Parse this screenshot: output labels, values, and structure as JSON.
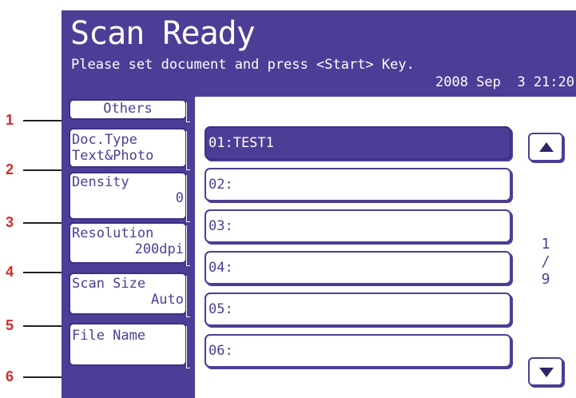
{
  "callouts": [
    "1",
    "2",
    "3",
    "4",
    "5",
    "6"
  ],
  "header": {
    "title": "Scan Ready",
    "subtitle": "Please set document and press <Start> Key.",
    "datetime": "2008 Sep  3 21:20"
  },
  "functions": {
    "others": "Others",
    "doc_type": {
      "label": "Doc.Type",
      "value": "Text&Photo"
    },
    "density": {
      "label": "Density",
      "value": "0"
    },
    "resolution": {
      "label": "Resolution",
      "value": "200dpi"
    },
    "scan_size": {
      "label": "Scan Size",
      "value": "Auto"
    },
    "file_name": {
      "label": "File Name",
      "value": ""
    }
  },
  "list": {
    "rows": [
      "01:TEST1",
      "02:",
      "03:",
      "04:",
      "05:",
      "06:"
    ],
    "selected_index": 0
  },
  "pager": {
    "current": "1",
    "separator": "/",
    "total": "9"
  },
  "icons": {
    "scroll_up": "triangle-up-icon",
    "scroll_down": "triangle-down-icon"
  },
  "colors": {
    "accent": "#4e3d96",
    "background_dark": "#1f1a40",
    "callout": "#d42a2a"
  }
}
